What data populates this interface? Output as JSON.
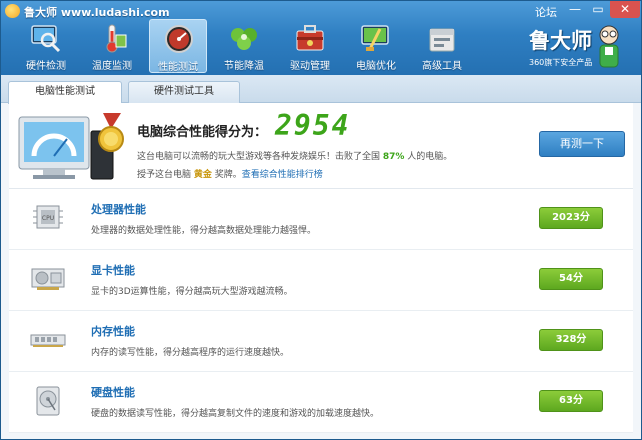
{
  "window": {
    "title": "鲁大师 www.ludashi.com",
    "forum": "论坛",
    "minimize": "—",
    "maximize": "▭",
    "close": "✕"
  },
  "nav": [
    {
      "label": "硬件检测",
      "icon": "magnifier-monitor-icon"
    },
    {
      "label": "温度监测",
      "icon": "thermometer-icon"
    },
    {
      "label": "性能测试",
      "icon": "speedometer-icon",
      "active": true
    },
    {
      "label": "节能降温",
      "icon": "leaf-icon"
    },
    {
      "label": "驱动管理",
      "icon": "toolbox-icon"
    },
    {
      "label": "电脑优化",
      "icon": "broom-monitor-icon"
    },
    {
      "label": "高级工具",
      "icon": "tool-case-icon"
    }
  ],
  "brand": {
    "name": "鲁大师",
    "tagline": "360旗下安全产品"
  },
  "tabs": [
    {
      "label": "电脑性能测试",
      "active": true
    },
    {
      "label": "硬件测试工具",
      "active": false
    }
  ],
  "summary": {
    "score_label": "电脑综合性能得分为：",
    "score_value": "2954",
    "desc_prefix": "这台电脑可以流畅的玩大型游戏等各种发烧娱乐！击败了全国 ",
    "desc_percent": "87%",
    "desc_suffix": " 人的电脑。",
    "award_prefix": "授予这台电脑 ",
    "award_medal": "黄金",
    "award_suffix": " 奖牌。",
    "rank_link": "查看综合性能排行榜",
    "retest_label": "再测一下"
  },
  "rows": [
    {
      "title": "处理器性能",
      "desc": "处理器的数据处理性能，得分越高数据处理能力越强悍。",
      "score": "2023分",
      "icon": "cpu-icon"
    },
    {
      "title": "显卡性能",
      "desc": "显卡的3D运算性能，得分越高玩大型游戏越流畅。",
      "score": "54分",
      "icon": "graphics-card-icon"
    },
    {
      "title": "内存性能",
      "desc": "内存的读写性能，得分越高程序的运行速度越快。",
      "score": "328分",
      "icon": "memory-icon"
    },
    {
      "title": "硬盘性能",
      "desc": "硬盘的数据读写性能，得分越高复制文件的速度和游戏的加载速度越快。",
      "score": "63分",
      "icon": "hard-disk-icon"
    }
  ]
}
